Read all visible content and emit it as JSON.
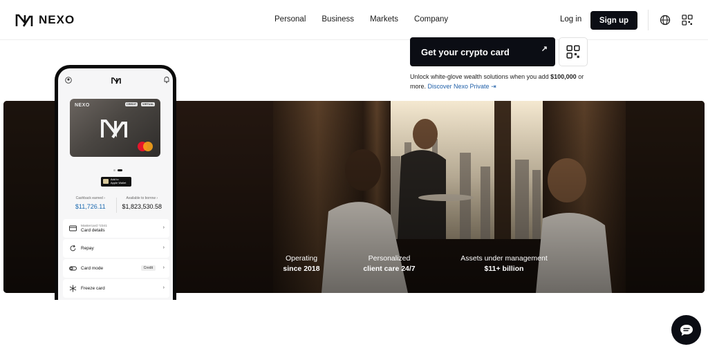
{
  "brand": {
    "name": "NEXO"
  },
  "nav": {
    "links": [
      "Personal",
      "Business",
      "Markets",
      "Company"
    ],
    "login": "Log in",
    "signup": "Sign up"
  },
  "cta": {
    "label": "Get your crypto card",
    "unlock_text": "Unlock white-glove wealth solutions when you add",
    "unlock_amount": "$100,000",
    "unlock_tail": "or more.",
    "discover_link": "Discover Nexo Private"
  },
  "phone": {
    "card_brand": "NEXO",
    "card_tag_credit": "CREDIT",
    "card_tag_virtual": "VIRTUAL",
    "apple_pay_line1": "Add to",
    "apple_pay_line2": "Apple Wallet",
    "cashback_label": "Cashback earned",
    "cashback_value": "$11,726.11",
    "borrow_label": "Available to borrow",
    "borrow_value": "$1,823,530.58",
    "rows": [
      {
        "sub": "Mastercard *2341",
        "label": "Card details",
        "pill": ""
      },
      {
        "sub": "",
        "label": "Repay",
        "pill": ""
      },
      {
        "sub": "",
        "label": "Card mode",
        "pill": "Credit"
      },
      {
        "sub": "",
        "label": "Freeze card",
        "pill": ""
      }
    ]
  },
  "stats": [
    {
      "label": "Operating",
      "value": "since 2018"
    },
    {
      "label": "Personalized",
      "value": "client care 24/7"
    },
    {
      "label": "Assets under management",
      "value": "$11+ billion"
    }
  ],
  "colors": {
    "dark": "#0b0d14",
    "link": "#1f5fa8",
    "cashback": "#1d6ab0"
  }
}
